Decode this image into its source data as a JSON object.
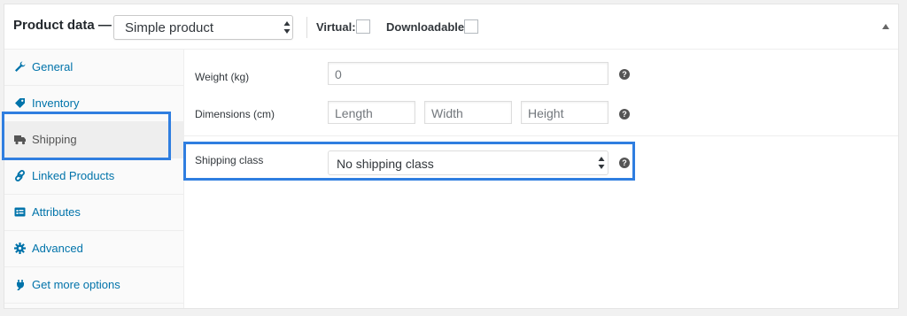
{
  "header": {
    "title": "Product data —",
    "product_type": "Simple product",
    "virtual_label": "Virtual:",
    "downloadable_label": "Downloadable:"
  },
  "sidebar": {
    "items": [
      {
        "label": "General",
        "icon": "wrench-icon"
      },
      {
        "label": "Inventory",
        "icon": "tag-icon"
      },
      {
        "label": "Shipping",
        "icon": "truck-icon",
        "active": true
      },
      {
        "label": "Linked Products",
        "icon": "link-icon"
      },
      {
        "label": "Attributes",
        "icon": "list-card-icon"
      },
      {
        "label": "Advanced",
        "icon": "gear-icon"
      },
      {
        "label": "Get more options",
        "icon": "plugin-icon"
      }
    ]
  },
  "shipping": {
    "weight_label": "Weight (kg)",
    "weight_placeholder": "0",
    "dimensions_label": "Dimensions (cm)",
    "length_placeholder": "Length",
    "width_placeholder": "Width",
    "height_placeholder": "Height",
    "class_label": "Shipping class",
    "class_value": "No shipping class"
  },
  "help_glyph": "?",
  "colors": {
    "link": "#0073aa",
    "highlight": "#2f7ee0"
  }
}
